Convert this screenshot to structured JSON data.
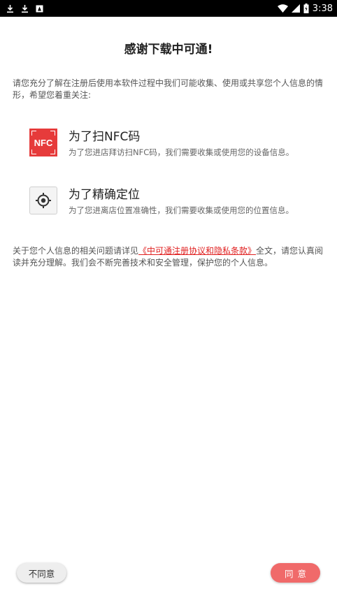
{
  "status_bar": {
    "time": "3:38",
    "icons": [
      "download-icon",
      "download-icon",
      "notification-icon",
      "wifi-icon",
      "signal-icon",
      "battery-icon"
    ]
  },
  "title": "感谢下载中可通!",
  "intro": "请您充分了解在注册后使用本软件过程中我们可能收集、使用或共享您个人信息的情形，希望您着重关注:",
  "features": [
    {
      "icon": "nfc-icon",
      "icon_text": "NFC",
      "title": "为了扫NFC码",
      "description": "为了您进店拜访扫NFC码，我们需要收集或使用您的设备信息。"
    },
    {
      "icon": "location-target-icon",
      "title": "为了精确定位",
      "description": "为了您进离店位置准确性，我们需要收集或使用您的位置信息。"
    }
  ],
  "notice": {
    "before": "关于您个人信息的相关问题请详见",
    "link": "《中可通注册协议和隐私条款》",
    "after": "全文，请您认真阅读并充分理解。我们会不断完善技术和安全管理，保护您的个人信息。"
  },
  "buttons": {
    "disagree": "不同意",
    "agree": "同意"
  },
  "colors": {
    "accent": "#e63b3b",
    "agree_button": "#f06a6a",
    "link": "#e02020",
    "status_bar": "#000000"
  }
}
